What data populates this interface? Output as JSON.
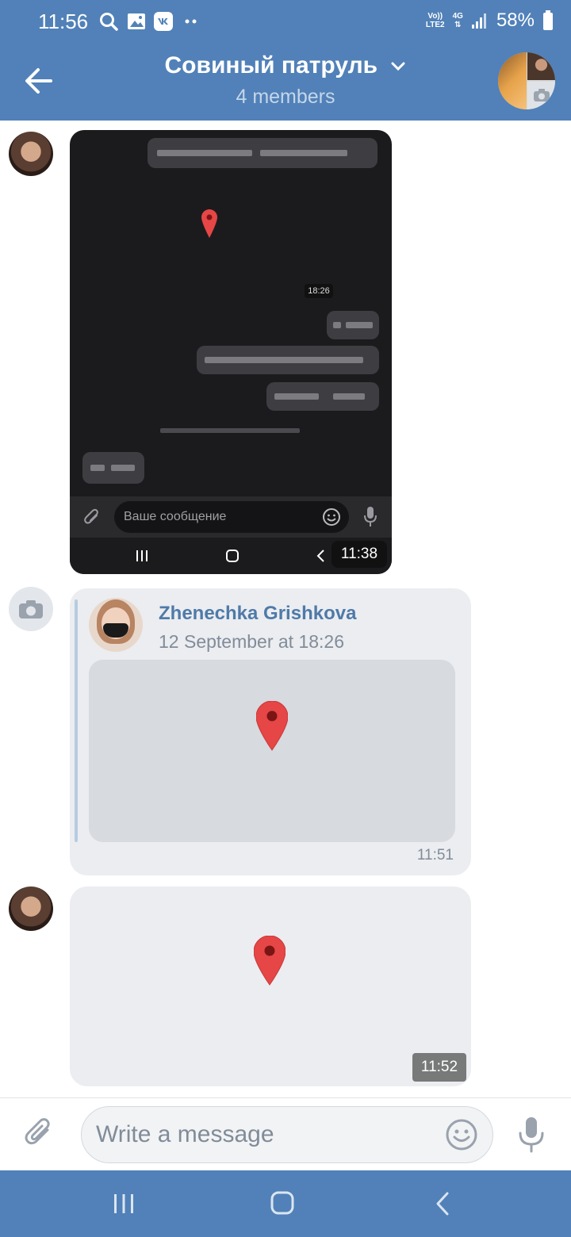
{
  "status_bar": {
    "time": "11:56",
    "network_top": "Vo))",
    "network_bottom": "LTE2",
    "signal_type": "4G",
    "battery": "58%",
    "icons": [
      "search-icon",
      "gallery-icon",
      "vk-icon",
      "more-dots-icon",
      "wifi-signal-icon",
      "battery-icon"
    ]
  },
  "header": {
    "title": "Совиный патруль",
    "subtitle": "4 members"
  },
  "screenshot_message": {
    "inner_timestamp": "18:26",
    "input_placeholder": "Ваше сообщение",
    "time": "11:38"
  },
  "forwarded_message": {
    "author": "Zhenechka Grishkova",
    "date": "12 September at 18:26",
    "time": "11:51"
  },
  "location_message": {
    "time": "11:52"
  },
  "composer": {
    "placeholder": "Write a message"
  },
  "colors": {
    "brand_blue": "#5181b8",
    "bubble_gray": "#ebedf0",
    "pin_red": "#e64646",
    "link_blue": "#4f7aa9"
  }
}
